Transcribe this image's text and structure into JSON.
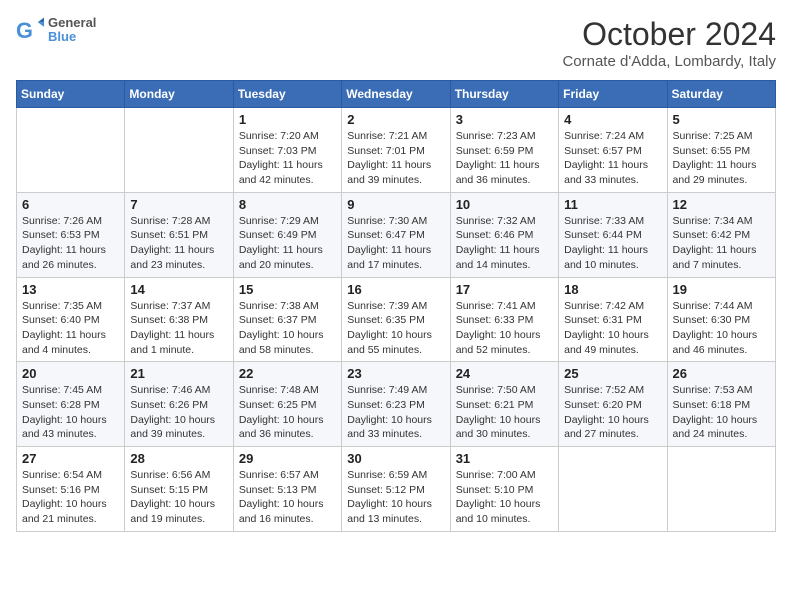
{
  "header": {
    "logo_general": "General",
    "logo_blue": "Blue",
    "month_title": "October 2024",
    "location": "Cornate d'Adda, Lombardy, Italy"
  },
  "weekdays": [
    "Sunday",
    "Monday",
    "Tuesday",
    "Wednesday",
    "Thursday",
    "Friday",
    "Saturday"
  ],
  "weeks": [
    [
      null,
      null,
      {
        "day": 1,
        "sunrise": "7:20 AM",
        "sunset": "7:03 PM",
        "daylight": "11 hours and 42 minutes."
      },
      {
        "day": 2,
        "sunrise": "7:21 AM",
        "sunset": "7:01 PM",
        "daylight": "11 hours and 39 minutes."
      },
      {
        "day": 3,
        "sunrise": "7:23 AM",
        "sunset": "6:59 PM",
        "daylight": "11 hours and 36 minutes."
      },
      {
        "day": 4,
        "sunrise": "7:24 AM",
        "sunset": "6:57 PM",
        "daylight": "11 hours and 33 minutes."
      },
      {
        "day": 5,
        "sunrise": "7:25 AM",
        "sunset": "6:55 PM",
        "daylight": "11 hours and 29 minutes."
      }
    ],
    [
      {
        "day": 6,
        "sunrise": "7:26 AM",
        "sunset": "6:53 PM",
        "daylight": "11 hours and 26 minutes."
      },
      {
        "day": 7,
        "sunrise": "7:28 AM",
        "sunset": "6:51 PM",
        "daylight": "11 hours and 23 minutes."
      },
      {
        "day": 8,
        "sunrise": "7:29 AM",
        "sunset": "6:49 PM",
        "daylight": "11 hours and 20 minutes."
      },
      {
        "day": 9,
        "sunrise": "7:30 AM",
        "sunset": "6:47 PM",
        "daylight": "11 hours and 17 minutes."
      },
      {
        "day": 10,
        "sunrise": "7:32 AM",
        "sunset": "6:46 PM",
        "daylight": "11 hours and 14 minutes."
      },
      {
        "day": 11,
        "sunrise": "7:33 AM",
        "sunset": "6:44 PM",
        "daylight": "11 hours and 10 minutes."
      },
      {
        "day": 12,
        "sunrise": "7:34 AM",
        "sunset": "6:42 PM",
        "daylight": "11 hours and 7 minutes."
      }
    ],
    [
      {
        "day": 13,
        "sunrise": "7:35 AM",
        "sunset": "6:40 PM",
        "daylight": "11 hours and 4 minutes."
      },
      {
        "day": 14,
        "sunrise": "7:37 AM",
        "sunset": "6:38 PM",
        "daylight": "11 hours and 1 minute."
      },
      {
        "day": 15,
        "sunrise": "7:38 AM",
        "sunset": "6:37 PM",
        "daylight": "10 hours and 58 minutes."
      },
      {
        "day": 16,
        "sunrise": "7:39 AM",
        "sunset": "6:35 PM",
        "daylight": "10 hours and 55 minutes."
      },
      {
        "day": 17,
        "sunrise": "7:41 AM",
        "sunset": "6:33 PM",
        "daylight": "10 hours and 52 minutes."
      },
      {
        "day": 18,
        "sunrise": "7:42 AM",
        "sunset": "6:31 PM",
        "daylight": "10 hours and 49 minutes."
      },
      {
        "day": 19,
        "sunrise": "7:44 AM",
        "sunset": "6:30 PM",
        "daylight": "10 hours and 46 minutes."
      }
    ],
    [
      {
        "day": 20,
        "sunrise": "7:45 AM",
        "sunset": "6:28 PM",
        "daylight": "10 hours and 43 minutes."
      },
      {
        "day": 21,
        "sunrise": "7:46 AM",
        "sunset": "6:26 PM",
        "daylight": "10 hours and 39 minutes."
      },
      {
        "day": 22,
        "sunrise": "7:48 AM",
        "sunset": "6:25 PM",
        "daylight": "10 hours and 36 minutes."
      },
      {
        "day": 23,
        "sunrise": "7:49 AM",
        "sunset": "6:23 PM",
        "daylight": "10 hours and 33 minutes."
      },
      {
        "day": 24,
        "sunrise": "7:50 AM",
        "sunset": "6:21 PM",
        "daylight": "10 hours and 30 minutes."
      },
      {
        "day": 25,
        "sunrise": "7:52 AM",
        "sunset": "6:20 PM",
        "daylight": "10 hours and 27 minutes."
      },
      {
        "day": 26,
        "sunrise": "7:53 AM",
        "sunset": "6:18 PM",
        "daylight": "10 hours and 24 minutes."
      }
    ],
    [
      {
        "day": 27,
        "sunrise": "6:54 AM",
        "sunset": "5:16 PM",
        "daylight": "10 hours and 21 minutes."
      },
      {
        "day": 28,
        "sunrise": "6:56 AM",
        "sunset": "5:15 PM",
        "daylight": "10 hours and 19 minutes."
      },
      {
        "day": 29,
        "sunrise": "6:57 AM",
        "sunset": "5:13 PM",
        "daylight": "10 hours and 16 minutes."
      },
      {
        "day": 30,
        "sunrise": "6:59 AM",
        "sunset": "5:12 PM",
        "daylight": "10 hours and 13 minutes."
      },
      {
        "day": 31,
        "sunrise": "7:00 AM",
        "sunset": "5:10 PM",
        "daylight": "10 hours and 10 minutes."
      },
      null,
      null
    ]
  ]
}
